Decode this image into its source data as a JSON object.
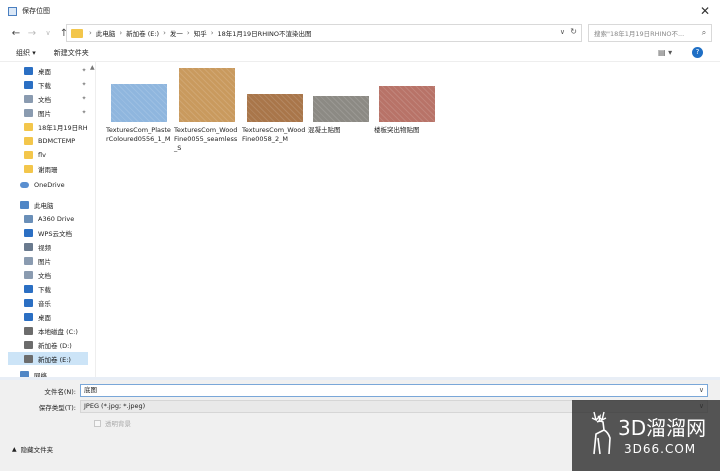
{
  "window": {
    "title": "保存位图"
  },
  "address": {
    "crumbs": [
      "此电脑",
      "新加卷 (E:)",
      "发一",
      "知乎",
      "18年1月19日RHINO不渲染出图"
    ],
    "search_placeholder": "搜索\"18年1月19日RHINO不..."
  },
  "toolbar": {
    "organize": "组织 ▾",
    "new_folder": "新建文件夹"
  },
  "sidebar": {
    "quick": [
      {
        "label": "桌面",
        "color": "#2b6fc3"
      },
      {
        "label": "下载",
        "color": "#2b6fc3"
      },
      {
        "label": "文档",
        "color": "#8a9bb0"
      },
      {
        "label": "图片",
        "color": "#8a9bb0"
      },
      {
        "label": "18年1月19日RH",
        "color": "#f3c64b"
      },
      {
        "label": "BDMCTEMP",
        "color": "#f3c64b"
      },
      {
        "label": "flv",
        "color": "#f3c64b"
      },
      {
        "label": "谢雨珊",
        "color": "#f3c64b"
      }
    ],
    "onedrive": "OneDrive",
    "thispc": "此电脑",
    "pc_items": [
      {
        "label": "A360 Drive",
        "color": "#6a8fb8"
      },
      {
        "label": "WPS云文档",
        "color": "#2b6fc3"
      },
      {
        "label": "视频",
        "color": "#6a7a8e"
      },
      {
        "label": "图片",
        "color": "#8a9bb0"
      },
      {
        "label": "文档",
        "color": "#8a9bb0"
      },
      {
        "label": "下载",
        "color": "#2b6fc3"
      },
      {
        "label": "音乐",
        "color": "#2b6fc3"
      },
      {
        "label": "桌面",
        "color": "#2b6fc3"
      },
      {
        "label": "本地磁盘 (C:)",
        "color": "#6c6c6c"
      },
      {
        "label": "新加卷 (D:)",
        "color": "#6c6c6c"
      },
      {
        "label": "新加卷 (E:)",
        "color": "#6c6c6c"
      }
    ],
    "network": "网络"
  },
  "files": [
    {
      "name": "TexturesCom_PlasterColoured0556_1_M",
      "color": "#8fb6de"
    },
    {
      "name": "TexturesCom_WoodFine0055_seamless_S",
      "color": "#c99a5e"
    },
    {
      "name": "TexturesCom_WoodFine0058_2_M",
      "color": "#a9764a"
    },
    {
      "name": "混凝土贴图",
      "color": "#8c8a84"
    },
    {
      "name": "楼板突出物贴图",
      "color": "#b87368"
    }
  ],
  "form": {
    "filename_label": "文件名(N):",
    "filename_value": "底图",
    "filetype_label": "保存类型(T):",
    "filetype_value": "JPEG (*.jpg; *.jpeg)",
    "checkbox_label": "透明背景",
    "hide_folders": "隐藏文件夹"
  },
  "watermark": {
    "cn": "3D溜溜网",
    "en": "3D66.COM"
  }
}
